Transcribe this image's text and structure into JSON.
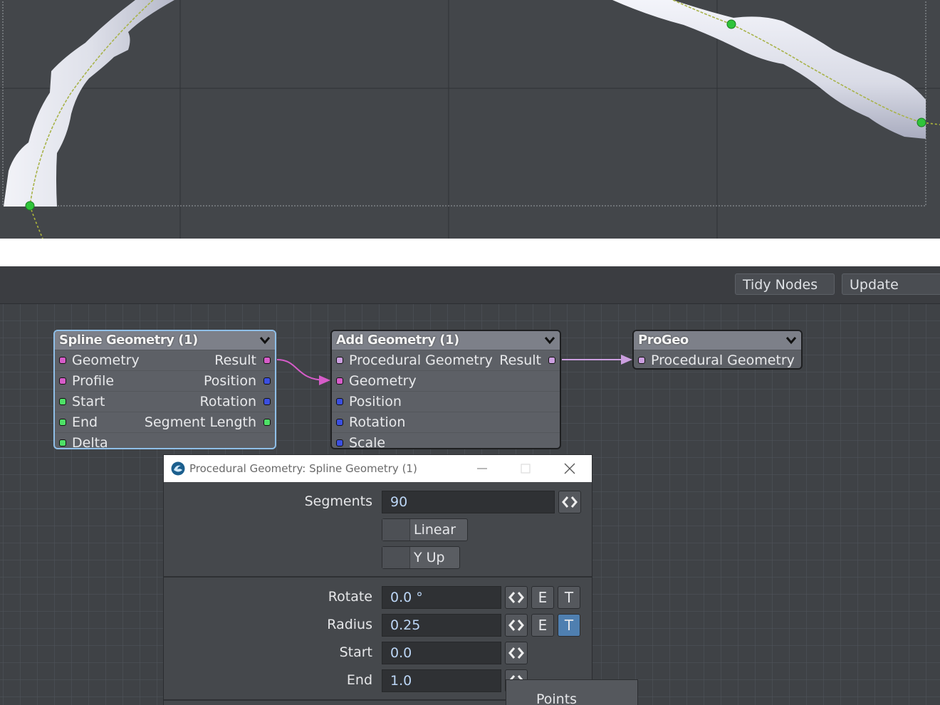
{
  "toolbar": {
    "tidy_label": "Tidy Nodes",
    "update_label": "Update"
  },
  "nodes": {
    "spline": {
      "title": "Spline Geometry (1)",
      "rows": [
        {
          "left": "Geometry",
          "right": "Result"
        },
        {
          "left": "Profile",
          "right": "Position"
        },
        {
          "left": "Start",
          "right": "Rotation"
        },
        {
          "left": "End",
          "right": "Segment Length"
        },
        {
          "left": "Delta",
          "right": ""
        }
      ]
    },
    "add": {
      "title": "Add Geometry (1)",
      "rows": [
        {
          "left": "Procedural Geometry",
          "right": "Result"
        },
        {
          "left": "Geometry",
          "right": ""
        },
        {
          "left": "Position",
          "right": ""
        },
        {
          "left": "Rotation",
          "right": ""
        },
        {
          "left": "Scale",
          "right": ""
        }
      ]
    },
    "progeo": {
      "title": "ProGeo",
      "rows": [
        {
          "left": "Procedural Geometry",
          "right": ""
        }
      ]
    }
  },
  "colors": {
    "geometry_port": "#d65cc9",
    "scalar_port": "#4ee067",
    "vector_port": "#3b4fe0",
    "procgeo_port": "#cc9fe0",
    "accent_selected": "#8fbfe8"
  },
  "window": {
    "title": "Procedural Geometry: Spline Geometry (1)",
    "segments_label": "Segments",
    "segments_value": "90",
    "linear_label": "Linear",
    "yup_label": "Y Up",
    "rotate_label": "Rotate",
    "rotate_value": "0.0 °",
    "radius_label": "Radius",
    "radius_value": "0.25",
    "start_label": "Start",
    "start_value": "0.0",
    "end_label": "End",
    "end_value": "1.0",
    "e_label": "E",
    "t_label": "T",
    "popup_label": "Points"
  }
}
